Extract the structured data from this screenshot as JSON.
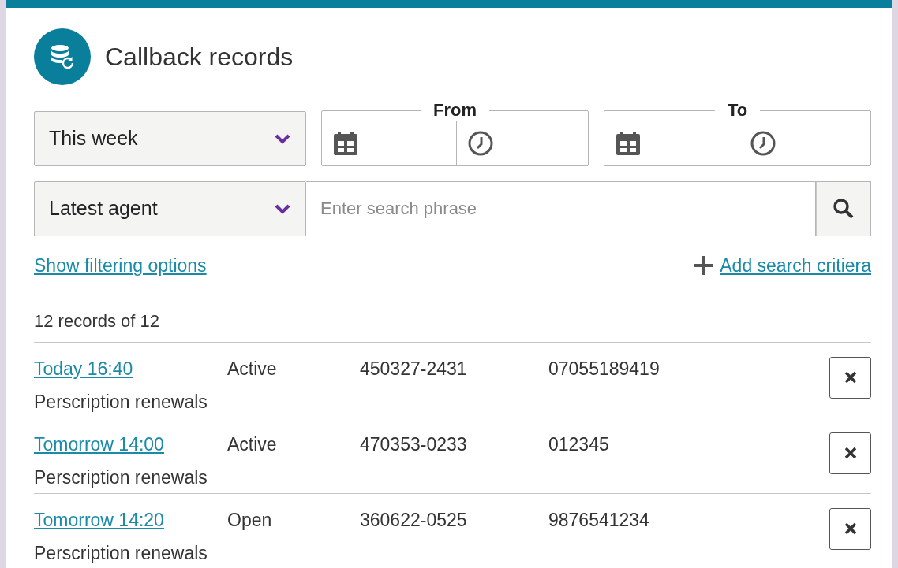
{
  "header": {
    "title": "Callback records"
  },
  "period_select": {
    "value": "This week"
  },
  "from": {
    "label": "From"
  },
  "to": {
    "label": "To"
  },
  "agent_select": {
    "value": "Latest agent"
  },
  "search": {
    "placeholder": "Enter search phrase"
  },
  "links": {
    "filter": "Show filtering options",
    "add": "Add search critiera"
  },
  "count": "12 records of 12",
  "records": [
    {
      "time": "Today 16:40",
      "status": "Active",
      "id": "450327-2431",
      "phone": "07055189419",
      "topic": "Perscription renewals"
    },
    {
      "time": "Tomorrow 14:00",
      "status": "Active",
      "id": "470353-0233",
      "phone": "012345",
      "topic": "Perscription renewals"
    },
    {
      "time": "Tomorrow 14:20",
      "status": "Open",
      "id": "360622-0525",
      "phone": "9876541234",
      "topic": "Perscription renewals"
    }
  ]
}
